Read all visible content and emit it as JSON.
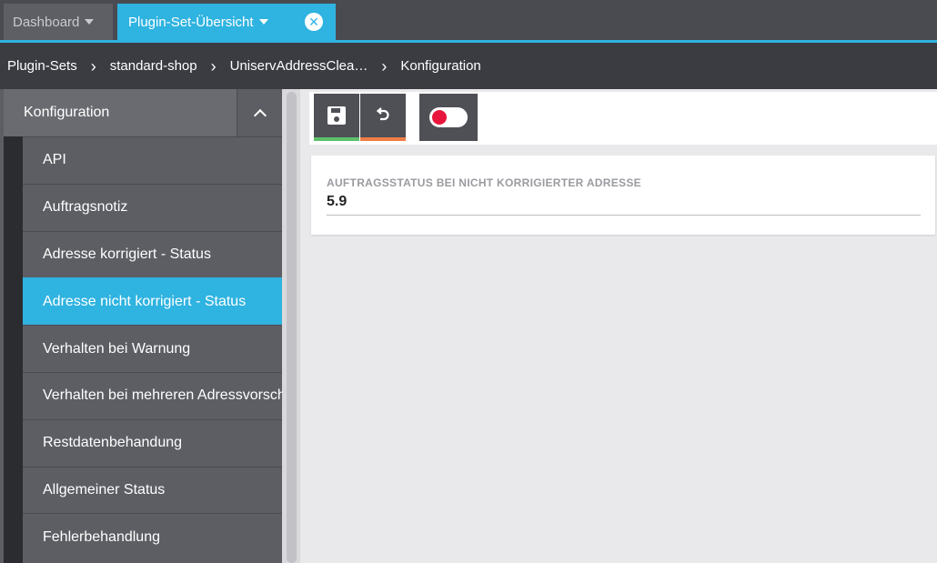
{
  "tabs": [
    {
      "label": "Dashboard"
    },
    {
      "label": "Plugin-Set-Übersicht"
    }
  ],
  "breadcrumb": [
    "Plugin-Sets",
    "standard-shop",
    "UniservAddressClea…",
    "Konfiguration"
  ],
  "sidebar": {
    "title": "Konfiguration",
    "items": [
      {
        "label": "API"
      },
      {
        "label": "Auftragsnotiz"
      },
      {
        "label": "Adresse korrigiert - Status"
      },
      {
        "label": "Adresse nicht korrigiert - Status",
        "active": true
      },
      {
        "label": "Verhalten bei Warnung"
      },
      {
        "label": "Verhalten bei mehreren Adressvorschlägen"
      },
      {
        "label": "Restdatenbehandung"
      },
      {
        "label": "Allgemeiner Status"
      },
      {
        "label": "Fehlerbehandlung"
      }
    ]
  },
  "toolbar": {
    "save_icon": "save-icon",
    "undo_icon": "undo-icon",
    "toggle_icon": "toggle-icon",
    "toggle_state": "off"
  },
  "field": {
    "label": "AUFTRAGSSTATUS BEI NICHT KORRIGIERTER ADRESSE",
    "value": "5.9"
  },
  "colors": {
    "accent": "#2fb3e0",
    "save": "#5cc06a",
    "undo": "#ee7d45",
    "toggle": "#e8163c"
  }
}
